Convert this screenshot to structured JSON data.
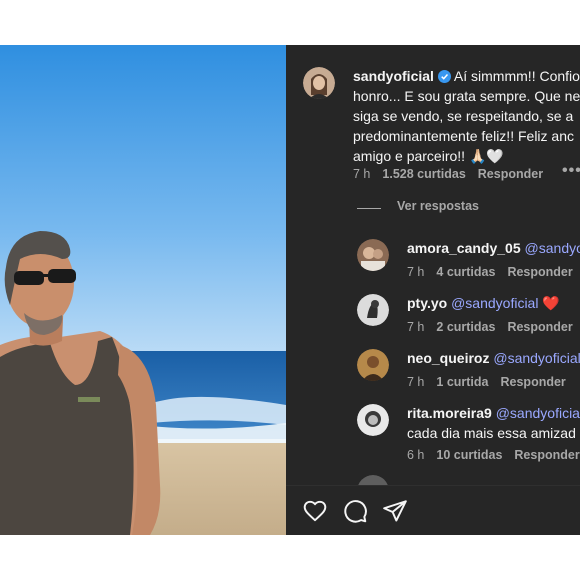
{
  "post_comment": {
    "username": "sandyoficial",
    "verified": true,
    "lines": [
      "Aí simmmm!! Confio",
      "honro... E sou grata sempre. Que ne",
      "siga se vendo, se respeitando, se a",
      "predominantemente feliz!! Feliz anc",
      "amigo e parceiro!! 🙏🏻🤍"
    ],
    "time": "7 h",
    "likes": "1.528 curtidas",
    "reply": "Responder"
  },
  "view_replies": "Ver respostas",
  "replies": [
    {
      "username": "amora_candy_05",
      "text": "@sandyo",
      "time": "7 h",
      "likes": "4 curtidas",
      "reply": "Responder"
    },
    {
      "username": "pty.yo",
      "text": "@sandyoficial",
      "emoji": "❤️",
      "time": "7 h",
      "likes": "2 curtidas",
      "reply": "Responder"
    },
    {
      "username": "neo_queiroz",
      "text": "@sandyoficial",
      "time": "7 h",
      "likes": "1 curtida",
      "reply": "Responder"
    },
    {
      "username": "rita.moreira9",
      "text": "@sandyoficia",
      "line2": "cada dia mais essa amizad",
      "time": "6 h",
      "likes": "10 curtidas",
      "reply": "Responder"
    }
  ],
  "icons": {
    "like": "heart-icon",
    "comment": "comment-icon",
    "share": "send-icon",
    "more": "more-dots-icon"
  },
  "colors": {
    "panel_bg": "#262626",
    "mention": "#9aa8ff",
    "muted": "#a8a8a8",
    "heart": "#ed4956",
    "verified": "#3897f0"
  }
}
